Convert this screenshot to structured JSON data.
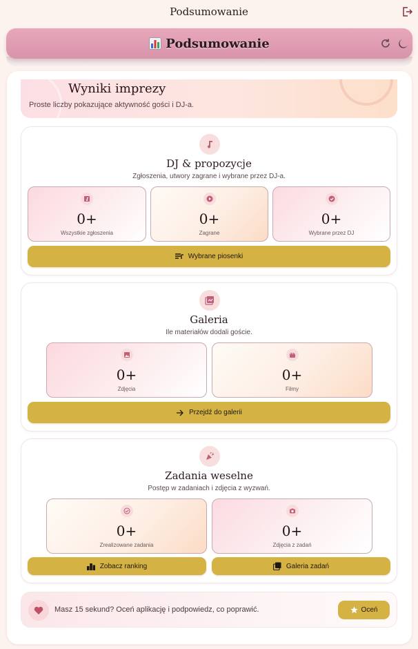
{
  "topbar": {
    "title": "Podsumowanie",
    "logout_icon": "logout-icon"
  },
  "header": {
    "title": "Podsumowanie",
    "icon": "bar-chart-icon",
    "refresh_icon": "refresh-icon",
    "theme_icon": "moon-icon"
  },
  "hero": {
    "title": "Wyniki imprezy",
    "subtitle": "Proste liczby pokazujące aktywność gości i DJ-a."
  },
  "sections": {
    "dj": {
      "icon": "music-note-icon",
      "title": "DJ & propozycje",
      "subtitle": "Zgłoszenia, utwory zagrane i wybrane przez DJ-a.",
      "stats": [
        {
          "icon": "music-library-icon",
          "value": "0+",
          "label": "Wszystkie zgłoszenia"
        },
        {
          "icon": "play-icon",
          "value": "0+",
          "label": "Zagrane"
        },
        {
          "icon": "check-circle-icon",
          "value": "0+",
          "label": "Wybrane przez DJ"
        }
      ],
      "button": {
        "icon": "playlist-icon",
        "label": "Wybrane piosenki"
      }
    },
    "gallery": {
      "icon": "photo-library-icon",
      "title": "Galeria",
      "subtitle": "Ile materiałów dodali goście.",
      "stats": [
        {
          "icon": "image-icon",
          "value": "0+",
          "label": "Zdjęcia"
        },
        {
          "icon": "movie-icon",
          "value": "0+",
          "label": "Filmy"
        }
      ],
      "button": {
        "icon": "arrow-right-icon",
        "label": "Przejdź do galerii"
      }
    },
    "tasks": {
      "icon": "party-popper-icon",
      "title": "Zadania weselne",
      "subtitle": "Postęp w zadaniach i zdjęcia z wyzwań.",
      "stats": [
        {
          "icon": "check-circle-outline-icon",
          "value": "0+",
          "label": "Zrealizowane zadania"
        },
        {
          "icon": "camera-icon",
          "value": "0+",
          "label": "Zdjęcia z zadań"
        }
      ],
      "buttons": [
        {
          "icon": "leaderboard-icon",
          "label": "Zobacz ranking"
        },
        {
          "icon": "gallery-icon",
          "label": "Galeria zadań"
        }
      ]
    }
  },
  "feedback": {
    "icon": "heart-icon",
    "text": "Masz 15 sekund? Oceń aplikację i podpowiedz, co poprawić.",
    "button": {
      "icon": "star-icon",
      "label": "Oceń"
    }
  },
  "colors": {
    "accent": "#d4b243",
    "header": "#e0a0b4",
    "icon_pink": "#c0607a",
    "background": "#fcf3ef"
  }
}
